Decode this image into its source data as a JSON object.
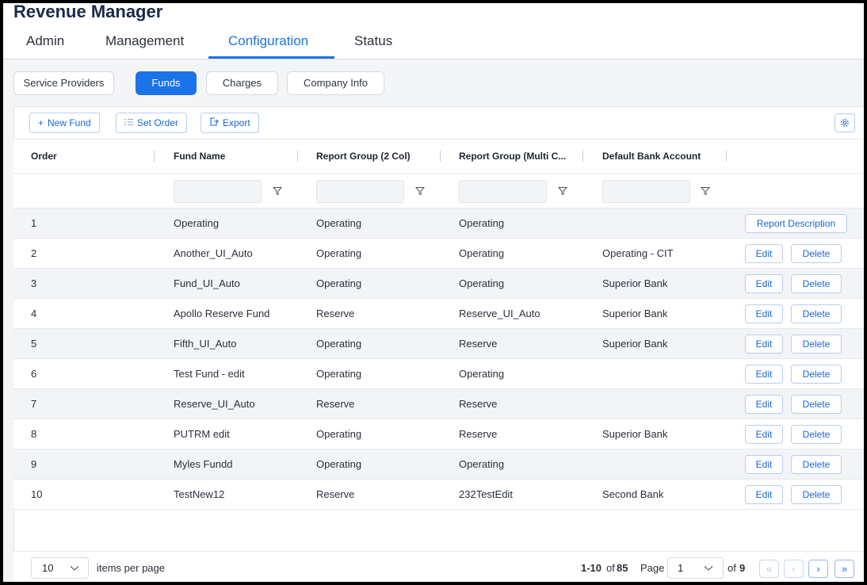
{
  "app": {
    "title": "Revenue Manager"
  },
  "main_tabs": [
    {
      "label": "Admin"
    },
    {
      "label": "Management"
    },
    {
      "label": "Configuration",
      "active": true
    },
    {
      "label": "Status"
    }
  ],
  "sub_tabs": [
    {
      "label": "Service Providers"
    },
    {
      "label": "Funds",
      "active": true
    },
    {
      "label": "Charges"
    },
    {
      "label": "Company Info"
    }
  ],
  "toolbar": {
    "new_fund": "New Fund",
    "set_order": "Set Order",
    "export": "Export",
    "settings_icon": "gear-icon"
  },
  "table": {
    "columns": [
      "Order",
      "Fund Name",
      "Report Group (2 Col)",
      "Report Group (Multi C...",
      "Default Bank Account"
    ],
    "rows": [
      {
        "order": "1",
        "fund": "Operating",
        "rg2": "Operating",
        "rgm": "Operating",
        "bank": "",
        "actions": [
          "Report Description"
        ]
      },
      {
        "order": "2",
        "fund": "Another_UI_Auto",
        "rg2": "Operating",
        "rgm": "Operating",
        "bank": "Operating - CIT",
        "actions": [
          "Edit",
          "Delete"
        ]
      },
      {
        "order": "3",
        "fund": "Fund_UI_Auto",
        "rg2": "Operating",
        "rgm": "Operating",
        "bank": "Superior Bank",
        "actions": [
          "Edit",
          "Delete"
        ]
      },
      {
        "order": "4",
        "fund": "Apollo Reserve Fund",
        "rg2": "Reserve",
        "rgm": "Reserve_UI_Auto",
        "bank": "Superior Bank",
        "actions": [
          "Edit",
          "Delete"
        ]
      },
      {
        "order": "5",
        "fund": "Fifth_UI_Auto",
        "rg2": "Operating",
        "rgm": "Reserve",
        "bank": "Superior Bank",
        "actions": [
          "Edit",
          "Delete"
        ]
      },
      {
        "order": "6",
        "fund": "Test Fund - edit",
        "rg2": "Operating",
        "rgm": "Operating",
        "bank": "",
        "actions": [
          "Edit",
          "Delete"
        ]
      },
      {
        "order": "7",
        "fund": "Reserve_UI_Auto",
        "rg2": "Reserve",
        "rgm": "Reserve",
        "bank": "",
        "actions": [
          "Edit",
          "Delete"
        ]
      },
      {
        "order": "8",
        "fund": "PUTRM edit",
        "rg2": "Operating",
        "rgm": "Reserve",
        "bank": "Superior Bank",
        "actions": [
          "Edit",
          "Delete"
        ]
      },
      {
        "order": "9",
        "fund": "Myles Fundd",
        "rg2": "Operating",
        "rgm": "Operating",
        "bank": "",
        "actions": [
          "Edit",
          "Delete"
        ]
      },
      {
        "order": "10",
        "fund": "TestNew12",
        "rg2": "Reserve",
        "rgm": "232TestEdit",
        "bank": "Second Bank",
        "actions": [
          "Edit",
          "Delete"
        ]
      }
    ]
  },
  "pagination": {
    "page_size": "10",
    "items_per_page_label": "items per page",
    "range": "1-10",
    "of_label": "of",
    "total": "85",
    "page_label": "Page",
    "page": "1",
    "of_pages_label": "of",
    "pages": "9"
  },
  "colors": {
    "accent": "#1a73e8",
    "row_alt": "#f2f4f7"
  }
}
